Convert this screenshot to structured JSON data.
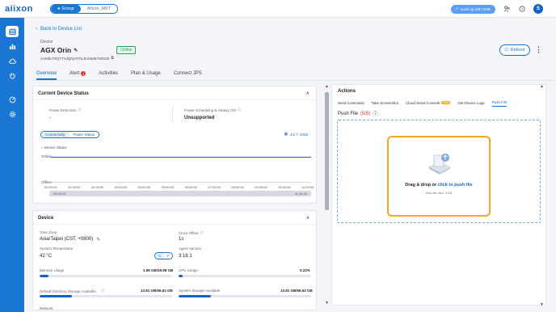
{
  "brand": {
    "logo": "aiixon",
    "accent": "#1976d2"
  },
  "topbar": {
    "group_label": "Group",
    "org_label": "Allxon_MKT",
    "level_up_label": "Level up with OOB",
    "avatar_initial": "S"
  },
  "sidebar": {
    "icons": [
      "devices-icon",
      "bar-chart-icon",
      "cloud-icon",
      "hand-icon",
      "dashboard-icon",
      "gear-icon"
    ]
  },
  "breadcrumb": {
    "back_label": "Back to Device List"
  },
  "device": {
    "label": "Device",
    "name": "AGX Orin",
    "status": "Online",
    "id": "AAMbuT9QTTvdQNjAFthLBAk58B7605S5",
    "reboot_label": "Reboot"
  },
  "tabs": [
    {
      "label": "Overview",
      "active": true
    },
    {
      "label": "Alert",
      "badge": "1"
    },
    {
      "label": "Activities"
    },
    {
      "label": "Plan & Usage"
    },
    {
      "label": "Connect JPS"
    }
  ],
  "status_card": {
    "title": "Current Device Status",
    "power_detection_label": "Power Detection",
    "power_detection_value": "-",
    "power_sched_label": "Power Scheduling & Always ON",
    "power_sched_value": "Unsupported",
    "seg_connectivity": "Connectivity",
    "seg_power": "Power Status",
    "date": "Jul 7, 2025",
    "legend": "Device Status",
    "y_top": "Online",
    "y_bottom": "Offline",
    "x_ticks": [
      "00:00:00",
      "01:00:00",
      "02:00:00",
      "03:00:00",
      "04:00:00",
      "05:00:00",
      "06:00:00",
      "07:00:00",
      "08:00:00",
      "09:00:00",
      "10:00:00",
      "11:00:00"
    ],
    "range_start": "00:00:00",
    "range_end": "11:14:34"
  },
  "device_card": {
    "title": "Device",
    "timezone_label": "Time Zone",
    "timezone_value": "Asia/Taipei (CST, +0800)",
    "clock_label": "Clock Offset",
    "clock_value": "1s",
    "temp_label": "System Temperature",
    "temp_value": "42 °C",
    "temp_toggle_c": "°C",
    "temp_toggle_f": "°F",
    "agent_label": "Agent Version",
    "agent_value": "3.16.1",
    "mem_label": "Memory Usage",
    "mem_value": "1.96 GB/29.98 GB",
    "mem_fraction": 0.065,
    "cpu_label": "CPU Usage",
    "cpu_value": "0.22%",
    "cpu_fraction": 0.0022,
    "dds_label": "Default Directory Storage Available",
    "dds_value": "13.81 GB/56.62 GB",
    "dds_fraction": 0.244,
    "sys_label": "System Storage Available",
    "sys_value": "13.81 GB/56.62 GB",
    "sys_fraction": 0.244,
    "network_label": "Network"
  },
  "actions": {
    "title": "Actions",
    "tabs": [
      {
        "label": "Send Command"
      },
      {
        "label": "Take Screenshot"
      },
      {
        "label": "Cloud Serial Console",
        "badge": "New"
      },
      {
        "label": "Get Device Logs"
      },
      {
        "label": "Push File",
        "active": true
      }
    ],
    "push_title": "Push File",
    "push_count": "(5/5)",
    "drop_text": "Drag & drop or",
    "drop_link": "click to push file",
    "max_size": "Max file size: 1GB"
  }
}
